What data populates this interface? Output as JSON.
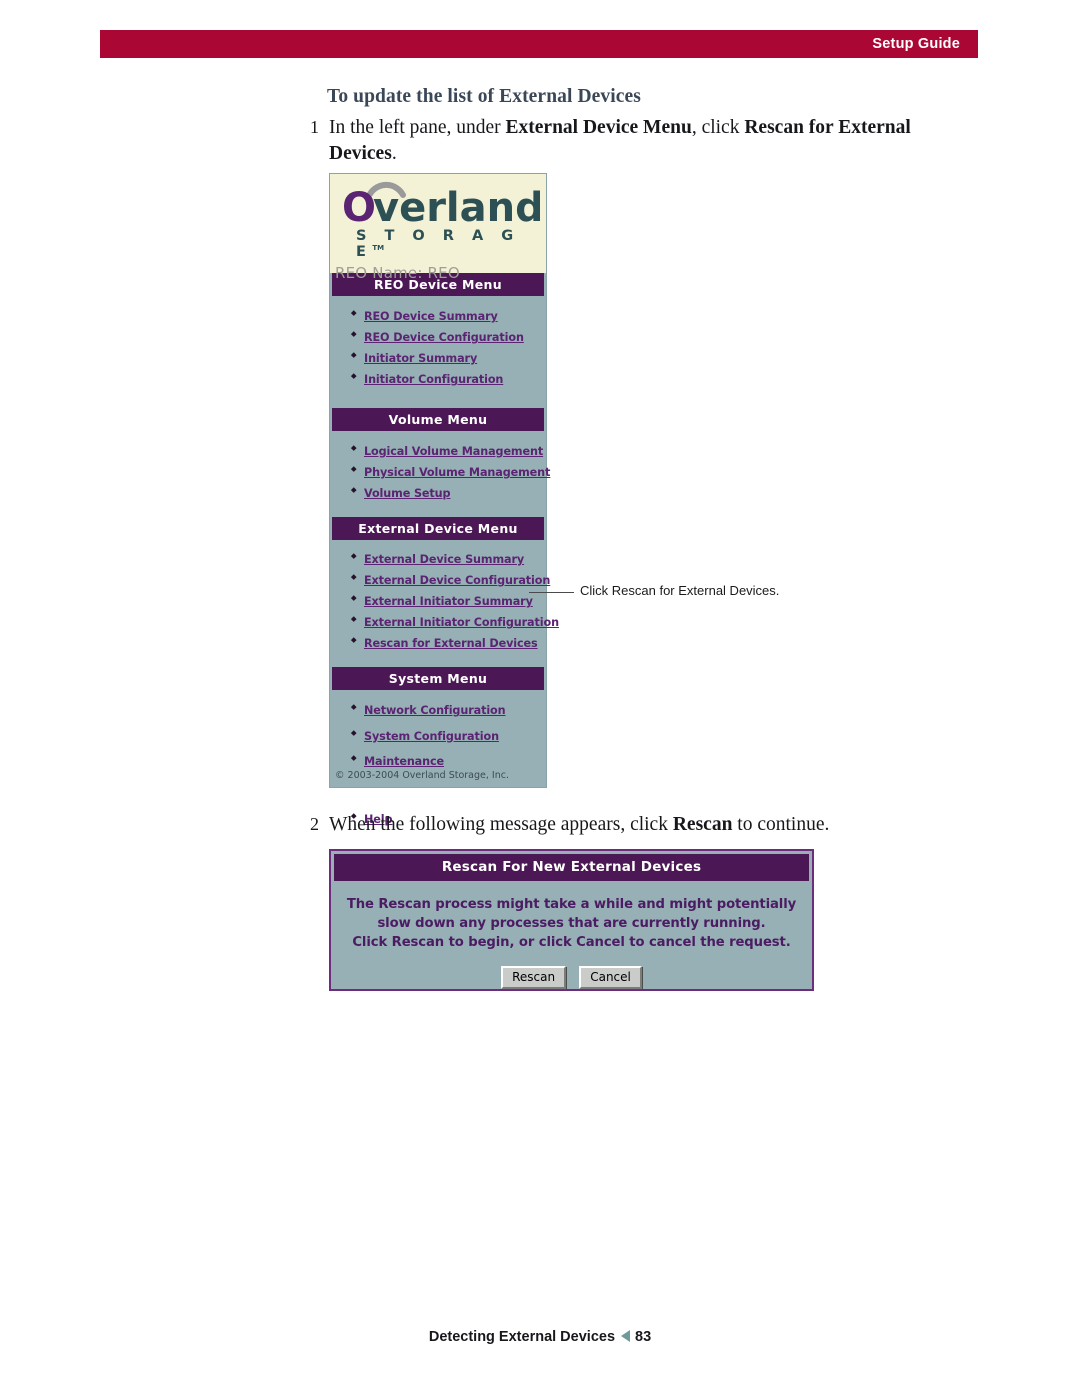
{
  "header": {
    "running_head": "Setup Guide",
    "bar_color": "#ab0734"
  },
  "main": {
    "section_heading": "To update the list of External Devices",
    "steps": [
      {
        "number": "1",
        "text_parts": [
          {
            "text": "In the left pane, under ",
            "bold": false
          },
          {
            "text": "External Device Menu",
            "bold": true
          },
          {
            "text": ", click ",
            "bold": false
          },
          {
            "text": "Rescan for External Devices",
            "bold": true
          },
          {
            "text": ".",
            "bold": false
          }
        ]
      },
      {
        "number": "2",
        "text_parts": [
          {
            "text": "When the following message appears, click ",
            "bold": false
          },
          {
            "text": "Rescan",
            "bold": true
          },
          {
            "text": " to continue.",
            "bold": false
          }
        ]
      }
    ],
    "callout": {
      "text": "Click Rescan for External Devices."
    }
  },
  "reo_panel": {
    "logo": {
      "wordmark": "Overland",
      "wordmark_initial": "O",
      "tagline": "S T O R A G E",
      "trademark": "TM",
      "swoosh_color": "#9a9a9a",
      "initial_color": "#5b2472",
      "word_color": "#2d5055",
      "background": "#f3f2d7"
    },
    "device_name_label": "REO Name: REO",
    "panel_background": "#97b0b5",
    "menu_header_color": "#4b1754",
    "link_color": "#5b2472",
    "sections": [
      {
        "header": "REO Device Menu",
        "items": [
          "REO Device Summary",
          "REO Device Configuration",
          "Initiator Summary",
          "Initiator Configuration"
        ]
      },
      {
        "header": "Volume Menu",
        "items": [
          "Logical Volume Management",
          "Physical Volume Management",
          "Volume Setup"
        ]
      },
      {
        "header": "External Device Menu",
        "items": [
          "External Device Summary",
          "External Device Configuration",
          "External Initiator Summary",
          "External Initiator Configuration",
          "Rescan for External Devices"
        ]
      },
      {
        "header": "System Menu",
        "items": [
          "Network Configuration",
          "System Configuration",
          "Maintenance"
        ],
        "extra_items": [
          "Help"
        ]
      }
    ],
    "copyright": "© 2003-2004 Overland Storage, Inc."
  },
  "rescan_dialog": {
    "title": "Rescan For New External Devices",
    "message_lines": [
      "The Rescan process might take a while and might potentially",
      "slow down any processes that are currently running.",
      "Click Rescan to begin, or click Cancel to cancel the request."
    ],
    "buttons": {
      "rescan": "Rescan",
      "cancel": "Cancel"
    },
    "border_color": "#6d2d7c",
    "titlebar_color": "#4b1754",
    "body_background": "#97b0b5"
  },
  "footer": {
    "chapter": "Detecting External Devices",
    "page_number": "83",
    "arrow_color": "#6f9a9a"
  }
}
